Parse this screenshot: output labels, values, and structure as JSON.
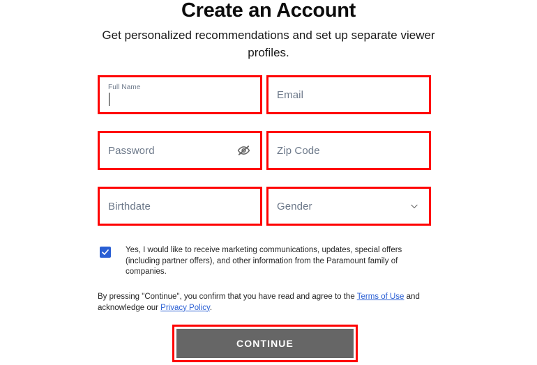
{
  "header": {
    "title": "Create an Account",
    "subtitle": "Get personalized recommendations and set up separate viewer profiles."
  },
  "form": {
    "fields": [
      {
        "name": "full-name",
        "label": "Full Name",
        "placeholder": "Full Name",
        "value": "",
        "state": "focused",
        "icon": null
      },
      {
        "name": "email",
        "label": "Email",
        "placeholder": "Email",
        "value": "",
        "state": "empty",
        "icon": null
      },
      {
        "name": "password",
        "label": "Password",
        "placeholder": "Password",
        "value": "",
        "state": "empty",
        "icon": "eye-off-icon"
      },
      {
        "name": "zip-code",
        "label": "Zip Code",
        "placeholder": "Zip Code",
        "value": "",
        "state": "empty",
        "icon": null
      },
      {
        "name": "birthdate",
        "label": "Birthdate",
        "placeholder": "Birthdate",
        "value": "",
        "state": "empty",
        "icon": null
      },
      {
        "name": "gender",
        "label": "Gender",
        "placeholder": "Gender",
        "value": "",
        "state": "empty",
        "icon": "chevron-down-icon"
      }
    ]
  },
  "consent": {
    "checked": true,
    "text": "Yes, I would like to receive marketing communications, updates, special offers (including partner offers), and other information from the Paramount family of companies."
  },
  "legal": {
    "prefix": "By pressing \"Continue\", you confirm that you have read and agree to the ",
    "terms_link": "Terms of Use",
    "middle": " and acknowledge our ",
    "privacy_link": "Privacy Policy",
    "suffix": "."
  },
  "cta": {
    "label": "CONTINUE"
  },
  "colors": {
    "highlight": "#ff0000",
    "checkbox": "#2a5fd4",
    "link": "#2a5fd4",
    "button_bg": "#666666",
    "button_text": "#ffffff",
    "placeholder": "#6d798a"
  }
}
